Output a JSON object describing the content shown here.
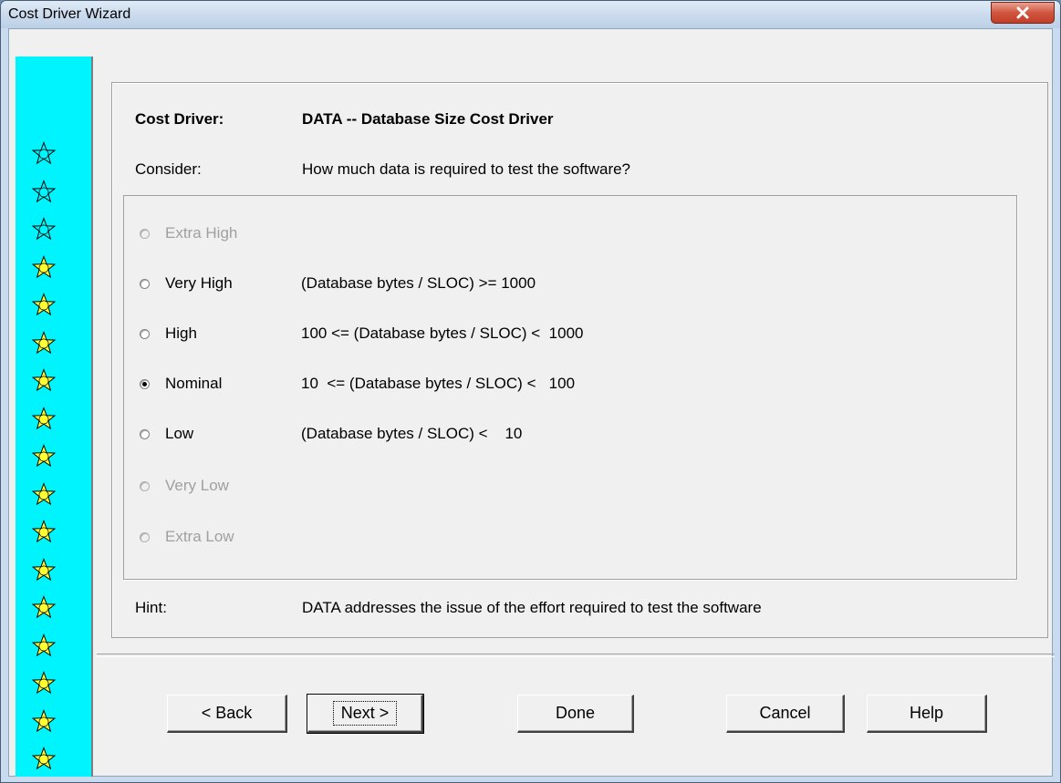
{
  "window": {
    "title": "Cost Driver Wizard"
  },
  "header": {
    "cost_driver_label": "Cost Driver:",
    "cost_driver_value": "DATA -- Database Size Cost Driver",
    "consider_label": "Consider:",
    "consider_value": "How much data is required to test the software?"
  },
  "ratings": [
    {
      "label": "Extra High",
      "description": "",
      "enabled": false,
      "selected": false
    },
    {
      "label": "Very High",
      "description": "(Database bytes / SLOC) >= 1000",
      "enabled": true,
      "selected": false
    },
    {
      "label": "High",
      "description": "100 <= (Database bytes / SLOC) <  1000",
      "enabled": true,
      "selected": false
    },
    {
      "label": "Nominal",
      "description": "10  <= (Database bytes / SLOC) <   100",
      "enabled": true,
      "selected": true
    },
    {
      "label": "Low",
      "description": "(Database bytes / SLOC) <    10",
      "enabled": true,
      "selected": false
    },
    {
      "label": "Very Low",
      "description": "",
      "enabled": false,
      "selected": false
    },
    {
      "label": "Extra Low",
      "description": "",
      "enabled": false,
      "selected": false
    }
  ],
  "hint": {
    "label": "Hint:",
    "value": "DATA addresses the issue of the effort required to test the software"
  },
  "buttons": {
    "back": "< Back",
    "next": "Next >",
    "done": "Done",
    "cancel": "Cancel",
    "help": "Help"
  },
  "progress": {
    "completed_steps": 3,
    "total_steps": 17
  },
  "colors": {
    "star_strip": "#00f4fd",
    "star_done_fill": "#00f4fd",
    "star_todo_fill": "#ffff33",
    "close_button": "#c84a34"
  }
}
